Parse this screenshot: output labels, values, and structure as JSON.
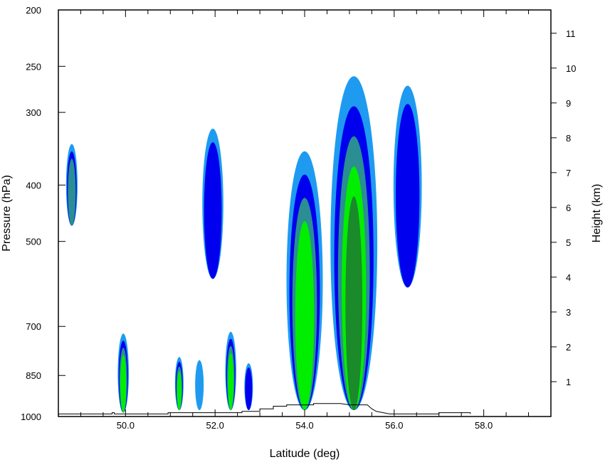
{
  "chart_data": {
    "type": "contour",
    "xlabel": "Latitude (deg)",
    "ylabel_left": "Pressure (hPa)",
    "ylabel_right": "Height (km)",
    "xlim": [
      48.5,
      59.5
    ],
    "ylim_pressure": [
      1000,
      200
    ],
    "y_scale": "log",
    "grid": false,
    "x_ticks": [
      {
        "value": 50.0,
        "label": "50.0"
      },
      {
        "value": 52.0,
        "label": "52.0"
      },
      {
        "value": 54.0,
        "label": "54.0"
      },
      {
        "value": 56.0,
        "label": "56.0"
      },
      {
        "value": 58.0,
        "label": "58.0"
      }
    ],
    "pressure_ticks": [
      {
        "value": 200,
        "label": "200"
      },
      {
        "value": 250,
        "label": "250"
      },
      {
        "value": 300,
        "label": "300"
      },
      {
        "value": 400,
        "label": "400"
      },
      {
        "value": 500,
        "label": "500"
      },
      {
        "value": 700,
        "label": "700"
      },
      {
        "value": 850,
        "label": "850"
      },
      {
        "value": 1000,
        "label": "1000"
      }
    ],
    "height_ticks": [
      {
        "value": 1,
        "label": "1"
      },
      {
        "value": 2,
        "label": "2"
      },
      {
        "value": 3,
        "label": "3"
      },
      {
        "value": 4,
        "label": "4"
      },
      {
        "value": 5,
        "label": "5"
      },
      {
        "value": 6,
        "label": "6"
      },
      {
        "value": 7,
        "label": "7"
      },
      {
        "value": 8,
        "label": "8"
      },
      {
        "value": 9,
        "label": "9"
      },
      {
        "value": 10,
        "label": "10"
      },
      {
        "value": 11,
        "label": "11"
      }
    ],
    "levels": [
      {
        "color": "#1e9bf0"
      },
      {
        "color": "#0000ee"
      },
      {
        "color": "#2a8e92"
      },
      {
        "color": "#00ee00"
      },
      {
        "color": "#1a8a2a"
      }
    ],
    "cells": [
      {
        "lat": 48.8,
        "p_top": 340,
        "p_bot": 470,
        "level": 2
      },
      {
        "lat": 49.95,
        "p_top": 720,
        "p_bot": 985,
        "level": 3
      },
      {
        "lat": 51.2,
        "p_top": 790,
        "p_bot": 975,
        "level": 3
      },
      {
        "lat": 51.65,
        "p_top": 800,
        "p_bot": 975,
        "level": 0
      },
      {
        "lat": 51.95,
        "p_top": 320,
        "p_bot": 580,
        "level": 1
      },
      {
        "lat": 52.35,
        "p_top": 715,
        "p_bot": 975,
        "level": 3
      },
      {
        "lat": 52.75,
        "p_top": 810,
        "p_bot": 975,
        "level": 1
      },
      {
        "lat": 54.0,
        "p_top": 350,
        "p_bot": 975,
        "level": 3
      },
      {
        "lat": 55.1,
        "p_top": 260,
        "p_bot": 975,
        "level": 4
      },
      {
        "lat": 56.3,
        "p_top": 270,
        "p_bot": 600,
        "level": 1
      }
    ],
    "terrain": [
      [
        48.5,
        990
      ],
      [
        49.7,
        990
      ],
      [
        49.7,
        985
      ],
      [
        49.75,
        985
      ],
      [
        49.75,
        990
      ],
      [
        50.95,
        990
      ],
      [
        50.95,
        985
      ],
      [
        52.6,
        985
      ],
      [
        52.6,
        980
      ],
      [
        53.0,
        980
      ],
      [
        53.0,
        970
      ],
      [
        53.3,
        970
      ],
      [
        53.3,
        960
      ],
      [
        53.6,
        960
      ],
      [
        53.6,
        955
      ],
      [
        54.2,
        955
      ],
      [
        54.2,
        950
      ],
      [
        54.8,
        950
      ],
      [
        55.0,
        955
      ],
      [
        55.4,
        955
      ],
      [
        55.5,
        970
      ],
      [
        55.6,
        980
      ],
      [
        55.9,
        990
      ],
      [
        57.0,
        990
      ],
      [
        57.0,
        985
      ],
      [
        57.7,
        985
      ],
      [
        57.7,
        990
      ]
    ]
  }
}
